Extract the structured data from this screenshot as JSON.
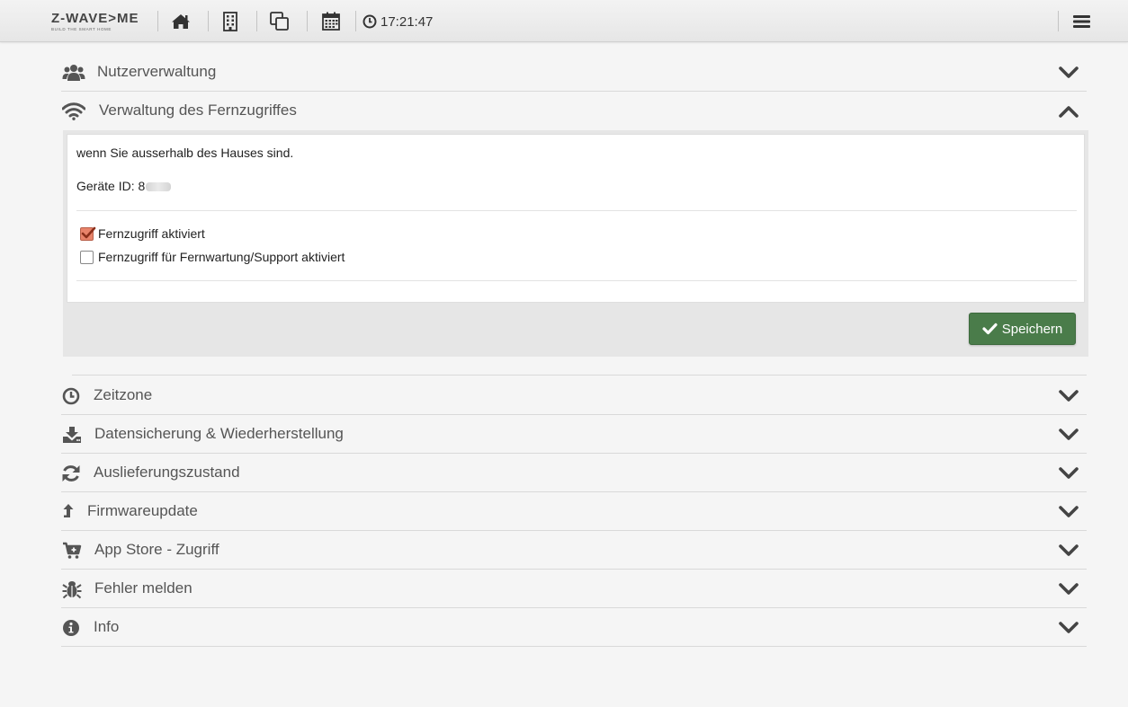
{
  "app": {
    "logo_text": "Z-WAVE>ME",
    "logo_tagline": "BUILD THE SMART HOME",
    "clock_time": "17:21:47"
  },
  "nav": [
    {
      "name": "home-icon"
    },
    {
      "name": "building-icon"
    },
    {
      "name": "copy-icon"
    },
    {
      "name": "calendar-icon"
    }
  ],
  "sections": {
    "user_management": {
      "label": "Nutzerverwaltung",
      "icon": "users-icon",
      "expanded": false
    },
    "remote_access": {
      "label": "Verwaltung des Fernzugriffes",
      "icon": "wifi-icon",
      "expanded": true
    },
    "timezone": {
      "label": "Zeitzone",
      "icon": "clock-icon",
      "expanded": false
    },
    "backup": {
      "label": "Datensicherung & Wiederherstellung",
      "icon": "download-icon",
      "expanded": false
    },
    "factory_reset": {
      "label": "Auslieferungszustand",
      "icon": "refresh-icon",
      "expanded": false
    },
    "firmware": {
      "label": "Firmwareupdate",
      "icon": "upload-arrow-icon",
      "expanded": false
    },
    "app_store": {
      "label": "App Store - Zugriff",
      "icon": "cart-plus-icon",
      "expanded": false
    },
    "report_bug": {
      "label": "Fehler melden",
      "icon": "bug-icon",
      "expanded": false
    },
    "info": {
      "label": "Info",
      "icon": "info-icon",
      "expanded": false
    }
  },
  "remote_access_panel": {
    "description": "wenn Sie ausserhalb des Hauses sind.",
    "device_id_label": "Geräte ID: 8",
    "checkboxes": [
      {
        "label": "Fernzugriff aktiviert",
        "checked": true
      },
      {
        "label": "Fernzugriff für Fernwartung/Support aktiviert",
        "checked": false
      }
    ],
    "save_label": "Speichern"
  },
  "colors": {
    "accent_checkbox": "#e8836a",
    "save_button": "#4a7c4a",
    "icon": "#555555",
    "chevron": "#444444"
  }
}
